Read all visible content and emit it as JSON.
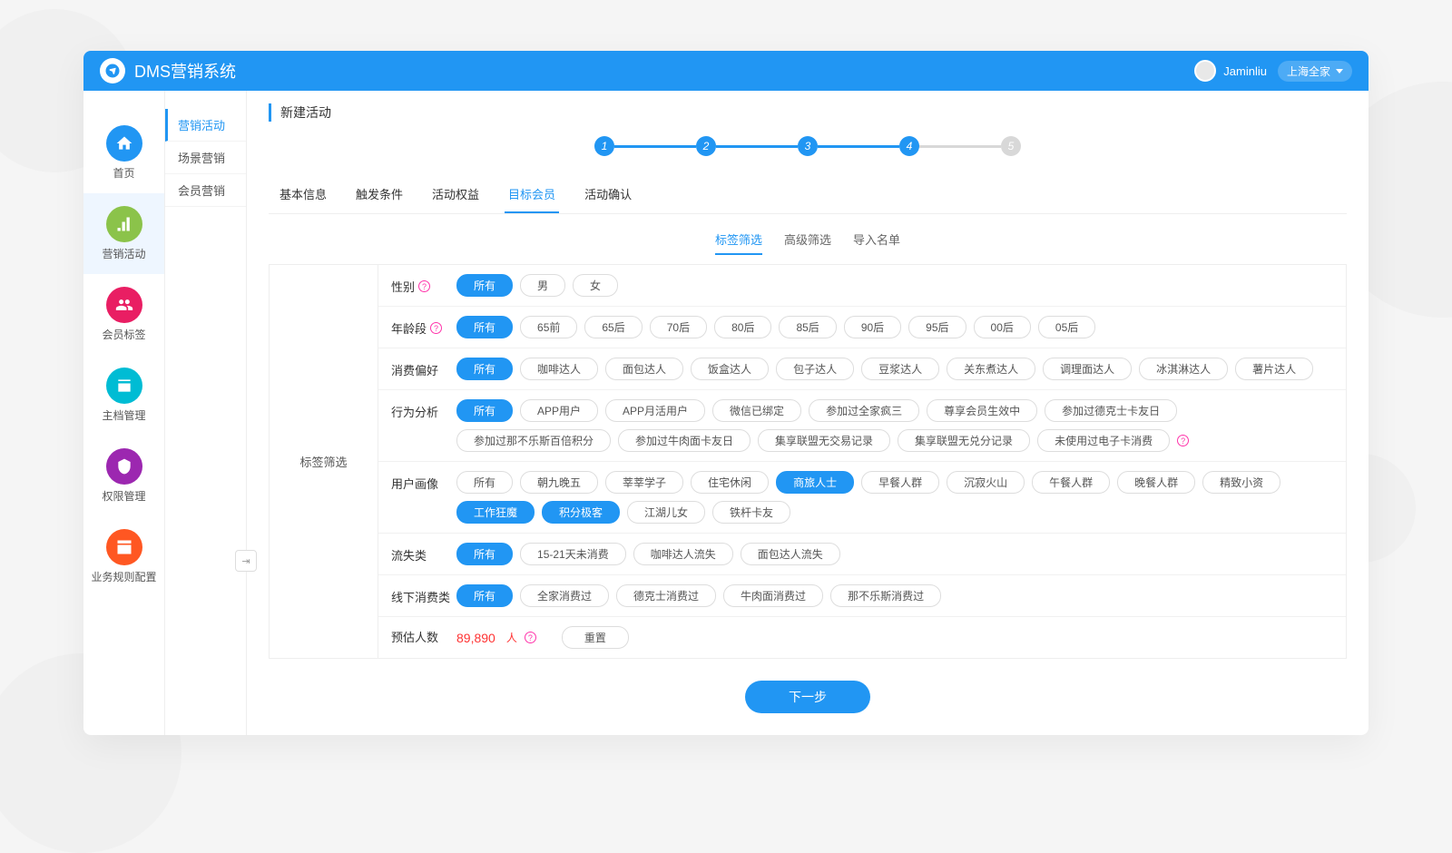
{
  "header": {
    "app_title": "DMS营销系统",
    "username": "Jaminliu",
    "store": "上海全家"
  },
  "sidebar": {
    "items": [
      {
        "label": "首页",
        "color": "#2196f3"
      },
      {
        "label": "营销活动",
        "color": "#8bc34a"
      },
      {
        "label": "会员标签",
        "color": "#e91e63"
      },
      {
        "label": "主档管理",
        "color": "#00bcd4"
      },
      {
        "label": "权限管理",
        "color": "#9c27b0"
      },
      {
        "label": "业务规则配置",
        "color": "#ff5722"
      }
    ]
  },
  "submenu": {
    "items": [
      "营销活动",
      "场景营销",
      "会员营销"
    ]
  },
  "page": {
    "title": "新建活动",
    "stepper": {
      "steps": [
        "1",
        "2",
        "3",
        "4",
        "5"
      ],
      "current": 4
    },
    "tabs": [
      "基本信息",
      "触发条件",
      "活动权益",
      "目标会员",
      "活动确认"
    ],
    "tabs_active": 3,
    "subtabs": [
      "标签筛选",
      "高级筛选",
      "导入名单"
    ],
    "subtabs_active": 0,
    "filter_side_label": "标签筛选",
    "next_label": "下一步"
  },
  "filters": [
    {
      "label": "性别",
      "help": true,
      "options": [
        "所有",
        "男",
        "女"
      ],
      "active": [
        0
      ]
    },
    {
      "label": "年龄段",
      "help": true,
      "options": [
        "所有",
        "65前",
        "65后",
        "70后",
        "80后",
        "85后",
        "90后",
        "95后",
        "00后",
        "05后"
      ],
      "active": [
        0
      ]
    },
    {
      "label": "消费偏好",
      "help": false,
      "options": [
        "所有",
        "咖啡达人",
        "面包达人",
        "饭盒达人",
        "包子达人",
        "豆浆达人",
        "关东煮达人",
        "调理面达人",
        "冰淇淋达人",
        "薯片达人"
      ],
      "active": [
        0
      ]
    },
    {
      "label": "行为分析",
      "help": false,
      "options": [
        "所有",
        "APP用户",
        "APP月活用户",
        "微信已绑定",
        "参加过全家疯三",
        "尊享会员生效中",
        "参加过德克士卡友日",
        "参加过那不乐斯百倍积分",
        "参加过牛肉面卡友日",
        "集享联盟无交易记录",
        "集享联盟无兑分记录",
        "未使用过电子卡消费"
      ],
      "active": [
        0
      ],
      "trailing_help": true
    },
    {
      "label": "用户画像",
      "help": false,
      "options": [
        "所有",
        "朝九晚五",
        "莘莘学子",
        "住宅休闲",
        "商旅人士",
        "早餐人群",
        "沉寂火山",
        "午餐人群",
        "晚餐人群",
        "精致小资",
        "工作狂魔",
        "积分极客",
        "江湖儿女",
        "铁杆卡友"
      ],
      "active": [
        4,
        10,
        11
      ]
    },
    {
      "label": "流失类",
      "help": false,
      "options": [
        "所有",
        "15-21天未消费",
        "咖啡达人流失",
        "面包达人流失"
      ],
      "active": [
        0
      ]
    },
    {
      "label": "线下消费类",
      "help": false,
      "options": [
        "所有",
        "全家消费过",
        "德克士消费过",
        "牛肉面消费过",
        "那不乐斯消费过"
      ],
      "active": [
        0
      ]
    }
  ],
  "estimate": {
    "label": "预估人数",
    "value": "89,890",
    "unit": "人",
    "reset_label": "重置"
  }
}
